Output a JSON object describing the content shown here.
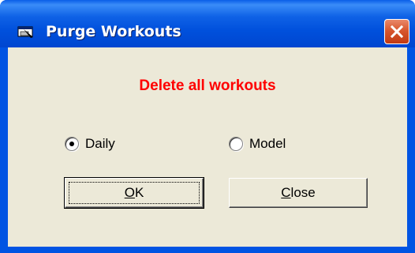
{
  "window": {
    "title": "Purge Workouts",
    "app_icon": "app-window-icon",
    "close_icon": "close-icon"
  },
  "dialog": {
    "heading": "Delete all workouts",
    "heading_color": "#ff0000",
    "options": [
      {
        "label": "Daily",
        "selected": true
      },
      {
        "label": "Model",
        "selected": false
      }
    ],
    "buttons": {
      "ok": {
        "mnemonic": "O",
        "rest": "K"
      },
      "close": {
        "mnemonic": "C",
        "rest": "lose"
      }
    }
  }
}
